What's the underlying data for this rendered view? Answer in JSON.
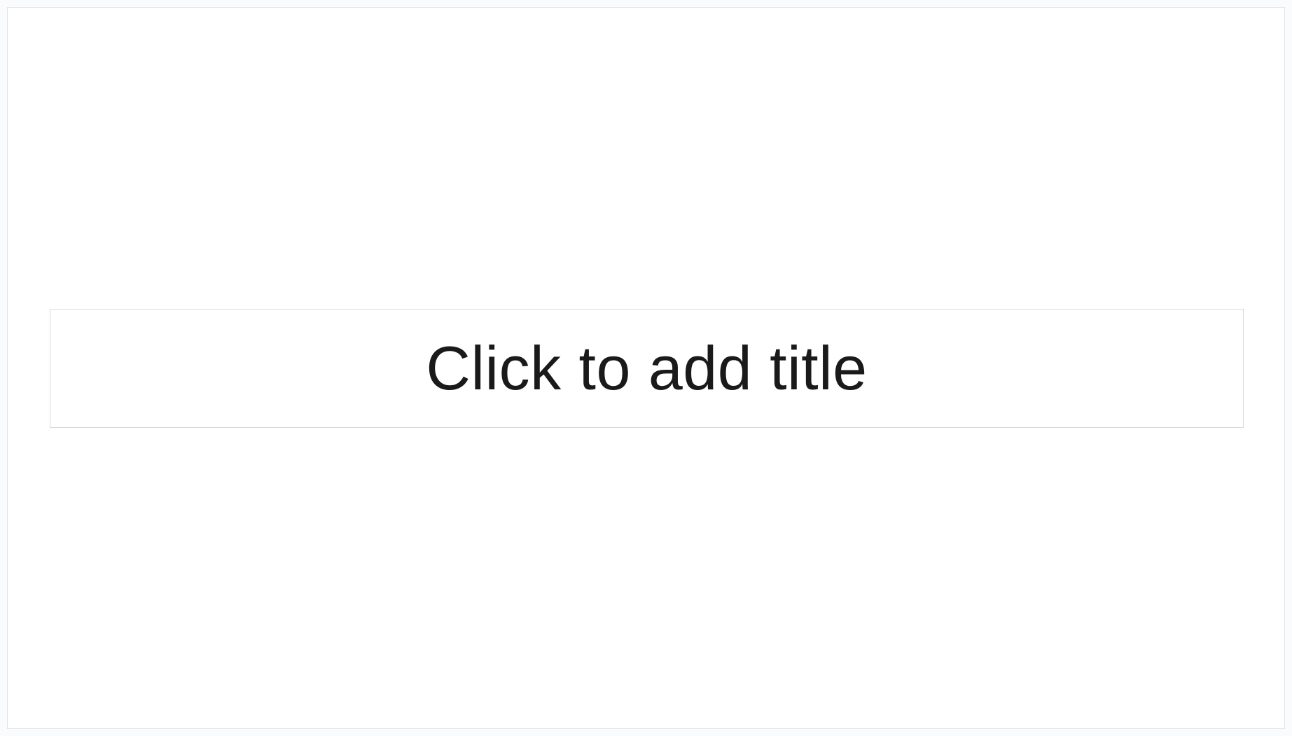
{
  "slide": {
    "title_placeholder": "Click to add title"
  }
}
